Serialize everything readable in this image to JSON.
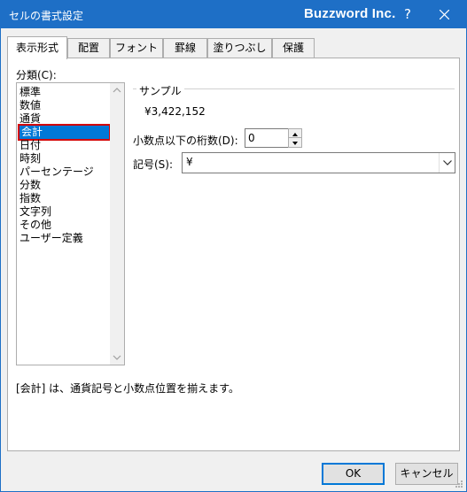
{
  "dialog": {
    "title": "セルの書式設定",
    "brand": "Buzzword Inc.",
    "help_label": "?"
  },
  "tabs": [
    {
      "label": "表示形式",
      "active": true
    },
    {
      "label": "配置",
      "active": false
    },
    {
      "label": "フォント",
      "active": false
    },
    {
      "label": "罫線",
      "active": false
    },
    {
      "label": "塗りつぶし",
      "active": false
    },
    {
      "label": "保護",
      "active": false
    }
  ],
  "category": {
    "label": "分類(C):",
    "items": [
      "標準",
      "数値",
      "通貨",
      "会計",
      "日付",
      "時刻",
      "パーセンテージ",
      "分数",
      "指数",
      "文字列",
      "その他",
      "ユーザー定義"
    ],
    "selected": "会計"
  },
  "sample": {
    "label": "サンプル",
    "value": "¥3,422,152"
  },
  "decimal": {
    "label": "小数点以下の桁数(D):",
    "value": "0"
  },
  "symbol": {
    "label": "記号(S):",
    "value": "¥"
  },
  "description": "[会計] は、通貨記号と小数点位置を揃えます。",
  "buttons": {
    "ok": "OK",
    "cancel": "キャンセル"
  },
  "colors": {
    "titlebar": "#1e6fc6",
    "selection": "#0078d7",
    "highlight_border": "#d40000"
  }
}
